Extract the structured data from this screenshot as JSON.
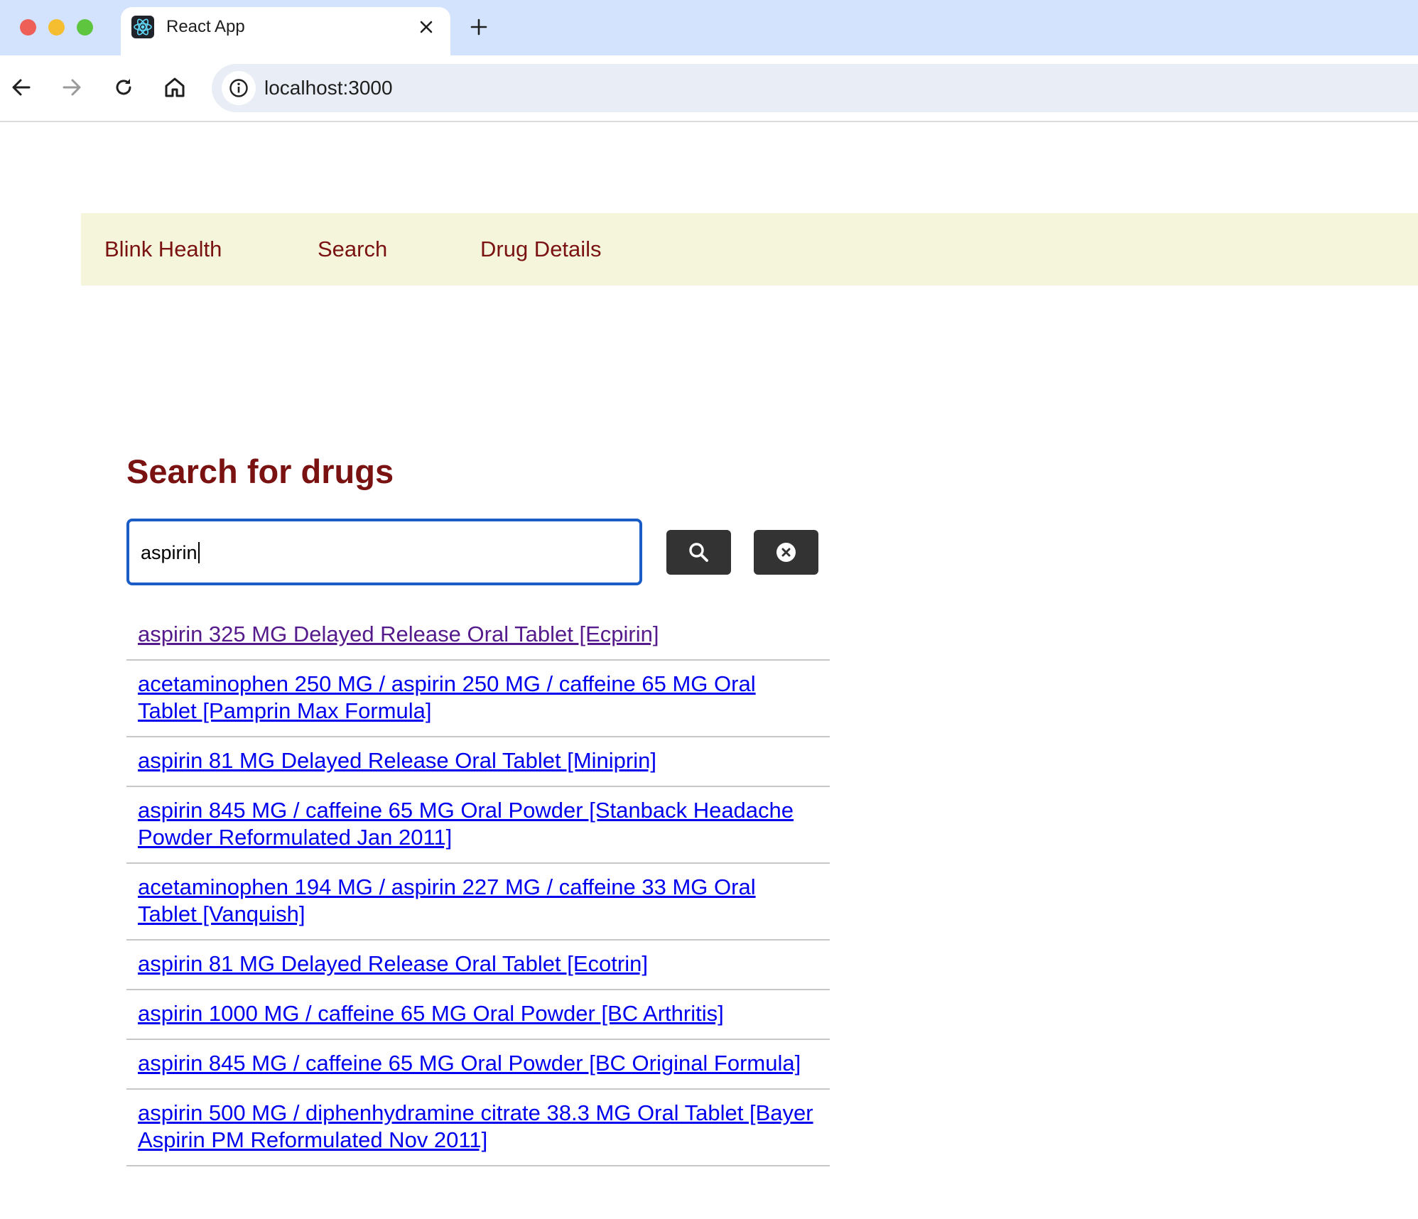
{
  "browser": {
    "tab_title": "React App",
    "url": "localhost:3000"
  },
  "nav": {
    "brand": "Blink Health",
    "search": "Search",
    "drug_details": "Drug Details"
  },
  "page": {
    "heading": "Search for drugs",
    "search_value": "aspirin"
  },
  "results": [
    {
      "label": "aspirin 325 MG Delayed Release Oral Tablet [Ecpirin]",
      "visited": true
    },
    {
      "label": "acetaminophen 250 MG / aspirin 250 MG / caffeine 65 MG Oral Tablet [Pamprin Max Formula]",
      "visited": false
    },
    {
      "label": "aspirin 81 MG Delayed Release Oral Tablet [Miniprin]",
      "visited": false
    },
    {
      "label": "aspirin 845 MG / caffeine 65 MG Oral Powder [Stanback Headache Powder Reformulated Jan 2011]",
      "visited": false
    },
    {
      "label": "acetaminophen 194 MG / aspirin 227 MG / caffeine 33 MG Oral Tablet [Vanquish]",
      "visited": false
    },
    {
      "label": "aspirin 81 MG Delayed Release Oral Tablet [Ecotrin]",
      "visited": false
    },
    {
      "label": "aspirin 1000 MG / caffeine 65 MG Oral Powder [BC Arthritis]",
      "visited": false
    },
    {
      "label": "aspirin 845 MG / caffeine 65 MG Oral Powder [BC Original Formula]",
      "visited": false
    },
    {
      "label": "aspirin 500 MG / diphenhydramine citrate 38.3 MG Oral Tablet [Bayer Aspirin PM Reformulated Nov 2011]",
      "visited": false
    }
  ],
  "colors": {
    "tab_strip": "#d3e3fd",
    "navbar_bg": "#f5f5dc",
    "brand_text": "#7a1212",
    "input_border": "#1a5dc7",
    "button_bg": "#333333",
    "link": "#0000ee",
    "link_visited": "#551a8b"
  },
  "icons": [
    "react-logo-icon",
    "close-icon",
    "plus-icon",
    "back-arrow-icon",
    "forward-arrow-icon",
    "reload-icon",
    "home-icon",
    "info-icon",
    "search-icon",
    "clear-circle-icon"
  ]
}
